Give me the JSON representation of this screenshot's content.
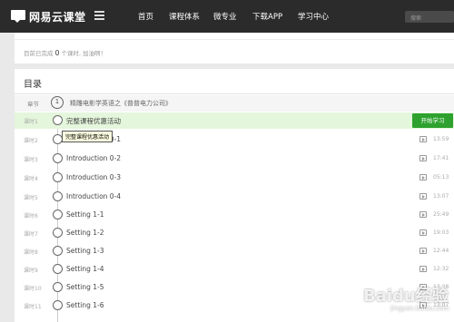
{
  "header": {
    "logo_text": "网易云课堂",
    "nav": [
      "首页",
      "课程体系",
      "微专业",
      "下载APP",
      "学习中心"
    ],
    "search_placeholder": "搜索"
  },
  "progress": {
    "prefix": "目前已完成",
    "count": "0",
    "suffix": "个课时, 加油啊！"
  },
  "directory": {
    "title": "目录",
    "chapter": {
      "label": "章节",
      "number": "1",
      "title": "精雕电影学英语之《普普电力公司》"
    },
    "start_button": "开始学习",
    "tooltip": "完整课程优惠活动",
    "lessons": [
      {
        "num": "课时1",
        "title": "完整课程优惠活动",
        "duration": ""
      },
      {
        "num": "课时2",
        "title": "Introduction 0-1",
        "duration": "13:59"
      },
      {
        "num": "课时3",
        "title": "Introduction 0-2",
        "duration": "17:41"
      },
      {
        "num": "课时4",
        "title": "Introduction 0-3",
        "duration": "05:13"
      },
      {
        "num": "课时5",
        "title": "Introduction 0-4",
        "duration": "13:07"
      },
      {
        "num": "课时6",
        "title": "Setting 1-1",
        "duration": "25:49"
      },
      {
        "num": "课时7",
        "title": "Setting 1-2",
        "duration": "19:03"
      },
      {
        "num": "课时8",
        "title": "Setting 1-3",
        "duration": "12:44"
      },
      {
        "num": "课时9",
        "title": "Setting 1-4",
        "duration": "12:32"
      },
      {
        "num": "课时10",
        "title": "Setting 1-5",
        "duration": "13:28"
      },
      {
        "num": "课时11",
        "title": "Setting 1-6",
        "duration": "13:07"
      }
    ]
  },
  "watermark": {
    "main": "Baidu经验",
    "sub": "jingyan.baidu.com"
  }
}
